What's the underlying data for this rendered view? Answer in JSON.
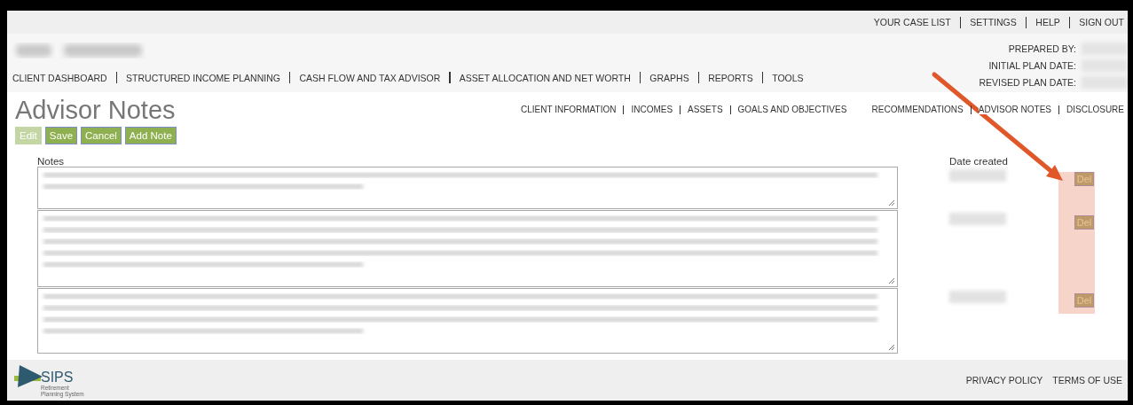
{
  "top_links": [
    "YOUR CASE LIST",
    "SETTINGS",
    "HELP",
    "SIGN OUT"
  ],
  "main_nav": [
    "CLIENT DASHBOARD",
    "STRUCTURED INCOME PLANNING",
    "CASH FLOW AND TAX ADVISOR",
    "ASSET ALLOCATION AND NET WORTH",
    "GRAPHS",
    "REPORTS",
    "TOOLS"
  ],
  "plan_info": [
    "PREPARED BY:",
    "INITIAL PLAN DATE:",
    "REVISED PLAN DATE:"
  ],
  "page_title": "Advisor Notes",
  "sub_nav_left": [
    "CLIENT INFORMATION",
    "INCOMES",
    "ASSETS",
    "GOALS AND OBJECTIVES"
  ],
  "sub_nav_right": [
    "RECOMMENDATIONS",
    "ADVISOR NOTES",
    "DISCLOSURE"
  ],
  "buttons": [
    {
      "label": "Edit",
      "disabled": true
    },
    {
      "label": "Save",
      "disabled": false
    },
    {
      "label": "Cancel",
      "disabled": false
    },
    {
      "label": "Add Note",
      "disabled": false
    }
  ],
  "notes_table": {
    "columns": [
      "Notes",
      "Date created"
    ],
    "rows": [
      {
        "delete_label": "Del"
      },
      {
        "delete_label": "Del"
      },
      {
        "delete_label": "Del"
      }
    ]
  },
  "footer": {
    "logo": {
      "name": "SIPS",
      "tagline": "Retirement Planning System"
    },
    "links": [
      "PRIVACY POLICY",
      "TERMS OF USE"
    ]
  }
}
